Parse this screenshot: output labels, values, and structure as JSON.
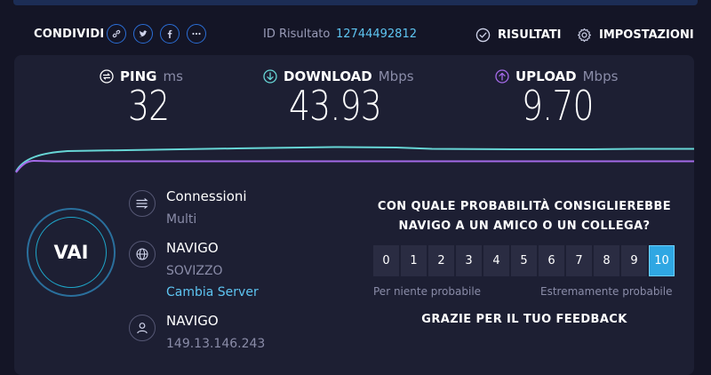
{
  "header": {
    "share_label": "CONDIVIDI",
    "share_icons": [
      "link-icon",
      "twitter-icon",
      "facebook-icon",
      "more-icon"
    ],
    "result_id_label": "ID Risultato",
    "result_id_value": "12744492812",
    "results_label": "RISULTATI",
    "settings_label": "IMPOSTAZIONI"
  },
  "metrics": {
    "ping": {
      "label": "PING",
      "unit": "ms",
      "value": "32"
    },
    "download": {
      "label": "DOWNLOAD",
      "unit": "Mbps",
      "value": "43.93"
    },
    "upload": {
      "label": "UPLOAD",
      "unit": "Mbps",
      "value": "9.70"
    }
  },
  "colors": {
    "download_line": "#67d6d6",
    "upload_line": "#a46ae8",
    "accent": "#2fa7e3",
    "link": "#5ec5f2"
  },
  "go_button": {
    "label": "VAI"
  },
  "info": {
    "connections": {
      "title": "Connessioni",
      "value": "Multi"
    },
    "server": {
      "title": "NAVIGO",
      "location": "SOVIZZO",
      "change_link": "Cambia Server"
    },
    "provider": {
      "title": "NAVIGO",
      "ip": "149.13.146.243"
    }
  },
  "survey": {
    "question": "CON QUALE PROBABILITÀ CONSIGLIEREBBE NAVIGO A UN AMICO O UN COLLEGA?",
    "scale": [
      "0",
      "1",
      "2",
      "3",
      "4",
      "5",
      "6",
      "7",
      "8",
      "9",
      "10"
    ],
    "selected": "10",
    "low_label": "Per niente probabile",
    "high_label": "Estremamente probabile",
    "thanks": "GRAZIE PER IL TUO FEEDBACK"
  }
}
